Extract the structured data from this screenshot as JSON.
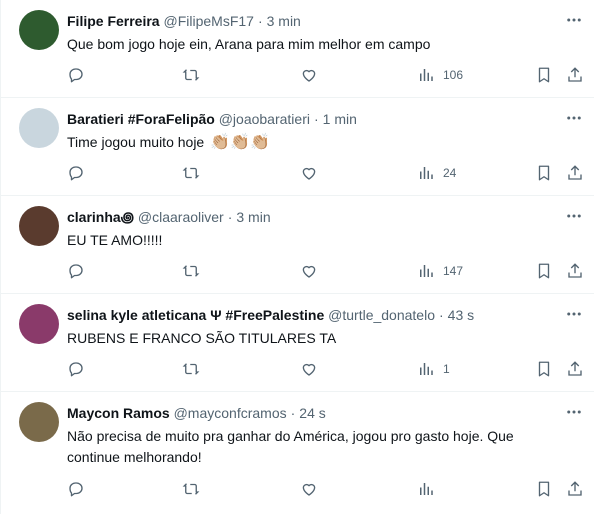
{
  "tweets": [
    {
      "name": "Filipe Ferreira",
      "handle": "@FilipeMsF17",
      "time": "3 min",
      "text": "Que bom jogo hoje ein, Arana para mim melhor em campo",
      "views": "106",
      "avatar_color": "#2e5b2f"
    },
    {
      "name": "Baratieri #ForaFelipão",
      "handle": "@joaobaratieri",
      "time": "1 min",
      "text": "Time jogou muito hoje",
      "emoji": "👏🏼👏🏼👏🏼",
      "views": "24",
      "avatar_color": "#c9d6de"
    },
    {
      "name": "clarinha꩜",
      "handle": "@claaraoliver",
      "time": "3 min",
      "text": "EU TE AMO!!!!!",
      "views": "147",
      "avatar_color": "#5a3b2e"
    },
    {
      "name": "selina kyle atleticana Ψ #FreePalestine",
      "handle": "@turtle_donatelo",
      "time": "43 s",
      "text": "RUBENS E FRANCO SÃO TITULARES TA",
      "views": "1",
      "avatar_color": "#8a3a6a"
    },
    {
      "name": "Maycon Ramos",
      "handle": "@mayconfcramos",
      "time": "24 s",
      "text": "Não precisa de muito pra ganhar do América, jogou pro gasto hoje. Que continue melhorando!",
      "views": "",
      "avatar_color": "#7a6a4a"
    }
  ],
  "icons": {
    "more": "more-icon",
    "reply": "reply-icon",
    "retweet": "retweet-icon",
    "like": "heart-icon",
    "views": "views-icon",
    "bookmark": "bookmark-icon",
    "share": "share-icon"
  }
}
